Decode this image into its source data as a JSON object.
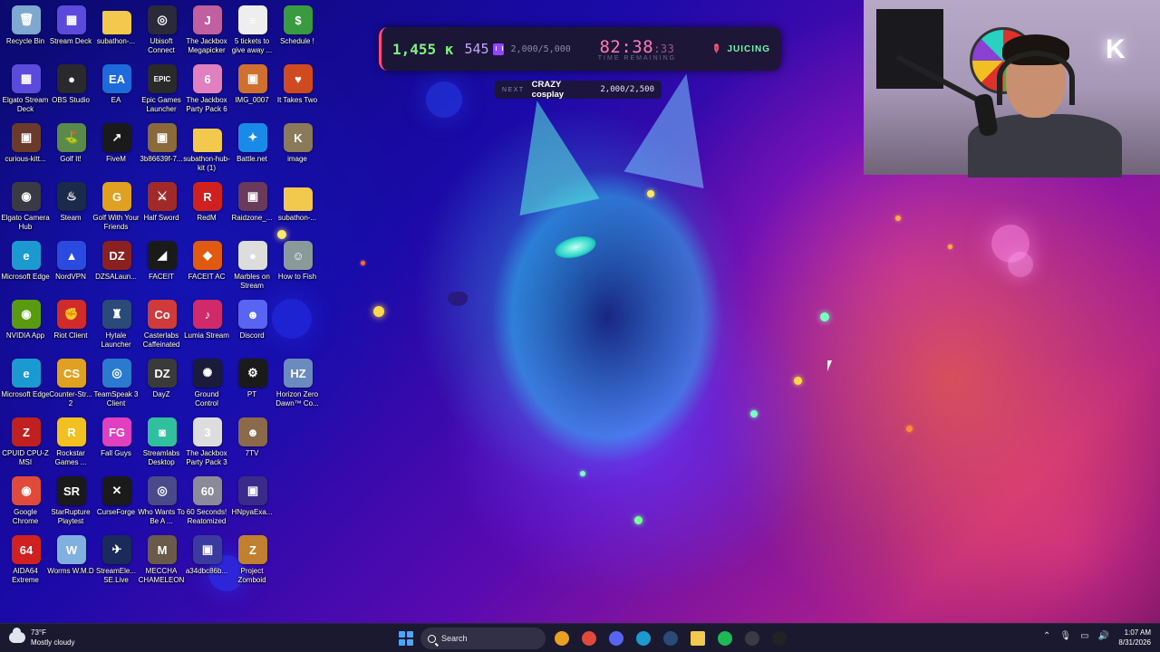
{
  "colors": {
    "wallpaper_blue": "#1a0aa8",
    "wallpaper_magenta": "#b0208a",
    "money_green": "#7cf57a",
    "timer_pink": "#ff7ab0",
    "twitch_purple": "#9146ff",
    "taskbar_bg": "#1c1a30"
  },
  "desktop": {
    "icons": [
      {
        "label": "Recycle Bin",
        "icon": "recycle-bin-icon",
        "color": "#7fa8d0",
        "glyph": "🗑"
      },
      {
        "label": "Stream Deck",
        "icon": "stream-deck-icon",
        "color": "#5b4bdc",
        "glyph": "▦"
      },
      {
        "label": "subathon-...",
        "icon": "folder-icon",
        "color": "#f2c94c",
        "glyph": ""
      },
      {
        "label": "Ubisoft Connect",
        "icon": "ubisoft-icon",
        "color": "#2a2a3a",
        "glyph": "◎"
      },
      {
        "label": "The Jackbox Megapicker",
        "icon": "jackbox-icon",
        "color": "#c060a0",
        "glyph": "J"
      },
      {
        "label": "5 tickets to give away ...",
        "icon": "text-file-icon",
        "color": "#eeeeee",
        "glyph": "≡"
      },
      {
        "label": "Schedule !",
        "icon": "schedule-icon",
        "color": "#3a9a40",
        "glyph": "$"
      },
      {
        "label": "Elgato Stream Deck",
        "icon": "stream-deck-icon",
        "color": "#5b4bdc",
        "glyph": "▦"
      },
      {
        "label": "OBS Studio",
        "icon": "obs-icon",
        "color": "#2a2a2e",
        "glyph": "●"
      },
      {
        "label": "EA",
        "icon": "ea-icon",
        "color": "#1e6adc",
        "glyph": "EA"
      },
      {
        "label": "Epic Games Launcher",
        "icon": "epic-games-icon",
        "color": "#2a2a2a",
        "glyph": "EPIC"
      },
      {
        "label": "The Jackbox Party Pack 6",
        "icon": "jackbox-icon",
        "color": "#e080c0",
        "glyph": "6"
      },
      {
        "label": "IMG_0007",
        "icon": "image-icon",
        "color": "#d07030",
        "glyph": "▣"
      },
      {
        "label": "It Takes Two",
        "icon": "it-takes-two-icon",
        "color": "#d04a20",
        "glyph": "♥"
      },
      {
        "label": "curious-kitt...",
        "icon": "image-icon",
        "color": "#6a3a2a",
        "glyph": "▣"
      },
      {
        "label": "Golf It!",
        "icon": "golf-it-icon",
        "color": "#5a8a4a",
        "glyph": "⛳"
      },
      {
        "label": "FiveM",
        "icon": "fivem-icon",
        "color": "#1a1a1a",
        "glyph": "↗"
      },
      {
        "label": "3b86639f-7...",
        "icon": "image-icon",
        "color": "#8a6a3a",
        "glyph": "▣"
      },
      {
        "label": "subathon-hub-kit (1)",
        "icon": "folder-icon",
        "color": "#f2c94c",
        "glyph": ""
      },
      {
        "label": "Battle.net",
        "icon": "battlenet-icon",
        "color": "#1a8ae8",
        "glyph": "✦"
      },
      {
        "label": "image",
        "icon": "image-icon",
        "color": "#8a7a5a",
        "glyph": "K"
      },
      {
        "label": "Elgato Camera Hub",
        "icon": "camera-hub-icon",
        "color": "#3a3a44",
        "glyph": "◉"
      },
      {
        "label": "Steam",
        "icon": "steam-icon",
        "color": "#1a2a4a",
        "glyph": "♨"
      },
      {
        "label": "Golf With Your Friends",
        "icon": "golf-friends-icon",
        "color": "#e0a020",
        "glyph": "G"
      },
      {
        "label": "Half Sword",
        "icon": "half-sword-icon",
        "color": "#a02a2a",
        "glyph": "⚔"
      },
      {
        "label": "RedM",
        "icon": "redm-icon",
        "color": "#d02020",
        "glyph": "R"
      },
      {
        "label": "Raidzone_...",
        "icon": "image-icon",
        "color": "#6a3a5a",
        "glyph": "▣"
      },
      {
        "label": "subathon-...",
        "icon": "folder-icon",
        "color": "#f2c94c",
        "glyph": ""
      },
      {
        "label": "Microsoft Edge",
        "icon": "edge-icon",
        "color": "#1a9ad0",
        "glyph": "e"
      },
      {
        "label": "NordVPN",
        "icon": "nordvpn-icon",
        "color": "#2a4ae0",
        "glyph": "▲"
      },
      {
        "label": "DZSALaun...",
        "icon": "dzsa-icon",
        "color": "#8a2020",
        "glyph": "DZ"
      },
      {
        "label": "FACEIT",
        "icon": "faceit-icon",
        "color": "#1a1a1a",
        "glyph": "◢"
      },
      {
        "label": "FACEIT AC",
        "icon": "faceit-ac-icon",
        "color": "#e05a10",
        "glyph": "◆"
      },
      {
        "label": "Marbles on Stream",
        "icon": "marbles-icon",
        "color": "#dddddd",
        "glyph": "●"
      },
      {
        "label": "How to Fish",
        "icon": "how-to-fish-icon",
        "color": "#8a9a9a",
        "glyph": "☺"
      },
      {
        "label": "NVIDIA App",
        "icon": "nvidia-icon",
        "color": "#5a9a10",
        "glyph": "◉"
      },
      {
        "label": "Riot Client",
        "icon": "riot-client-icon",
        "color": "#d02a2a",
        "glyph": "✊"
      },
      {
        "label": "Hytale Launcher",
        "icon": "hytale-icon",
        "color": "#2a4a7a",
        "glyph": "♜"
      },
      {
        "label": "Casterlabs Caffeinated",
        "icon": "casterlabs-icon",
        "color": "#d03a3a",
        "glyph": "Co"
      },
      {
        "label": "Lumia Stream",
        "icon": "lumia-icon",
        "color": "#d02a6a",
        "glyph": "♪"
      },
      {
        "label": "Discord",
        "icon": "discord-icon",
        "color": "#5865f2",
        "glyph": "☻"
      },
      null,
      {
        "label": "Microsoft Edge",
        "icon": "edge-icon",
        "color": "#1a9ad0",
        "glyph": "e"
      },
      {
        "label": "Counter-Str... 2",
        "icon": "counter-strike-icon",
        "color": "#e0a020",
        "glyph": "CS"
      },
      {
        "label": "TeamSpeak 3 Client",
        "icon": "teamspeak-icon",
        "color": "#2a7ad0",
        "glyph": "◎"
      },
      {
        "label": "DayZ",
        "icon": "dayz-icon",
        "color": "#3a3a3a",
        "glyph": "DZ"
      },
      {
        "label": "Ground Control",
        "icon": "ground-control-icon",
        "color": "#1a1a3a",
        "glyph": "✺"
      },
      {
        "label": "PT",
        "icon": "pt-icon",
        "color": "#1a1a1a",
        "glyph": "⚙"
      },
      {
        "label": "Horizon Zero Dawn™ Co...",
        "icon": "horizon-icon",
        "color": "#6a8ac0",
        "glyph": "HZ"
      },
      {
        "label": "CPUID CPU-Z MSI",
        "icon": "cpuz-icon",
        "color": "#c02020",
        "glyph": "Z"
      },
      {
        "label": "Rockstar Games ...",
        "icon": "rockstar-icon",
        "color": "#f2c020",
        "glyph": "R"
      },
      {
        "label": "Fall Guys",
        "icon": "fall-guys-icon",
        "color": "#e040c0",
        "glyph": "FG"
      },
      {
        "label": "Streamlabs Desktop",
        "icon": "streamlabs-icon",
        "color": "#30c0a0",
        "glyph": "◙"
      },
      {
        "label": "The Jackbox Party Pack 3",
        "icon": "jackbox-icon",
        "color": "#dddddd",
        "glyph": "3"
      },
      {
        "label": "7TV",
        "icon": "seventv-icon",
        "color": "#8a6a4a",
        "glyph": "☻"
      },
      null,
      {
        "label": "Google Chrome",
        "icon": "chrome-icon",
        "color": "#e04a3a",
        "glyph": "◉"
      },
      {
        "label": "StarRupture Playtest",
        "icon": "starrupture-icon",
        "color": "#1a1a1a",
        "glyph": "SR"
      },
      {
        "label": "CurseForge",
        "icon": "curseforge-icon",
        "color": "#1a1a1a",
        "glyph": "✕"
      },
      {
        "label": "Who Wants To Be A ...",
        "icon": "millionaire-icon",
        "color": "#4a4a8a",
        "glyph": "◎"
      },
      {
        "label": "60 Seconds! Reatomized",
        "icon": "sixty-seconds-icon",
        "color": "#8a8a9a",
        "glyph": "60"
      },
      {
        "label": "HNpyaExa...",
        "icon": "image-icon",
        "color": "#3a2a8a",
        "glyph": "▣"
      },
      null,
      {
        "label": "AIDA64 Extreme",
        "icon": "aida64-icon",
        "color": "#d02020",
        "glyph": "64"
      },
      {
        "label": "Worms W.M.D",
        "icon": "worms-icon",
        "color": "#80b0e0",
        "glyph": "W"
      },
      {
        "label": "StreamEle... SE.Live",
        "icon": "streamelements-icon",
        "color": "#1a2a5a",
        "glyph": "✈"
      },
      {
        "label": "MECCHA CHAMELEON",
        "icon": "meccha-icon",
        "color": "#6a5a4a",
        "glyph": "M"
      },
      {
        "label": "a34dbc86b...",
        "icon": "image-icon",
        "color": "#3a3aa0",
        "glyph": "▣"
      },
      {
        "label": "Project Zomboid",
        "icon": "project-zomboid-icon",
        "color": "#c08030",
        "glyph": "Z"
      },
      null
    ]
  },
  "subathon": {
    "money": "1,455 к",
    "subs": "545",
    "subs_goal": "2,000/5,000",
    "timer_main": "82:38",
    "timer_ms": ":33",
    "timer_label": "TIME REMAINING",
    "status": "JUICING",
    "next_tag": "NEXT",
    "next_name": "CRAZY cosplay",
    "next_progress": "2,000/2,500"
  },
  "taskbar": {
    "weather_temp": "73°F",
    "weather_desc": "Mostly cloudy",
    "search_placeholder": "Search",
    "time": "1:07 AM",
    "date": "8/31/2026",
    "pinned_apps": [
      {
        "name": "edge-pinned-icon",
        "color": "#e8a020"
      },
      {
        "name": "chrome-pinned-icon",
        "color": "#e04a3a"
      },
      {
        "name": "discord-pinned-icon",
        "color": "#5865f2"
      },
      {
        "name": "edge-browser-pinned-icon",
        "color": "#1a9ad0"
      },
      {
        "name": "steam-pinned-icon",
        "color": "#2a4a7a"
      },
      {
        "name": "file-explorer-pinned-icon",
        "color": "#f2c94c"
      },
      {
        "name": "spotify-pinned-icon",
        "color": "#1db954"
      },
      {
        "name": "obs-pinned-icon",
        "color": "#3a3a44"
      },
      {
        "name": "terminal-pinned-icon",
        "color": "#222222"
      }
    ]
  }
}
